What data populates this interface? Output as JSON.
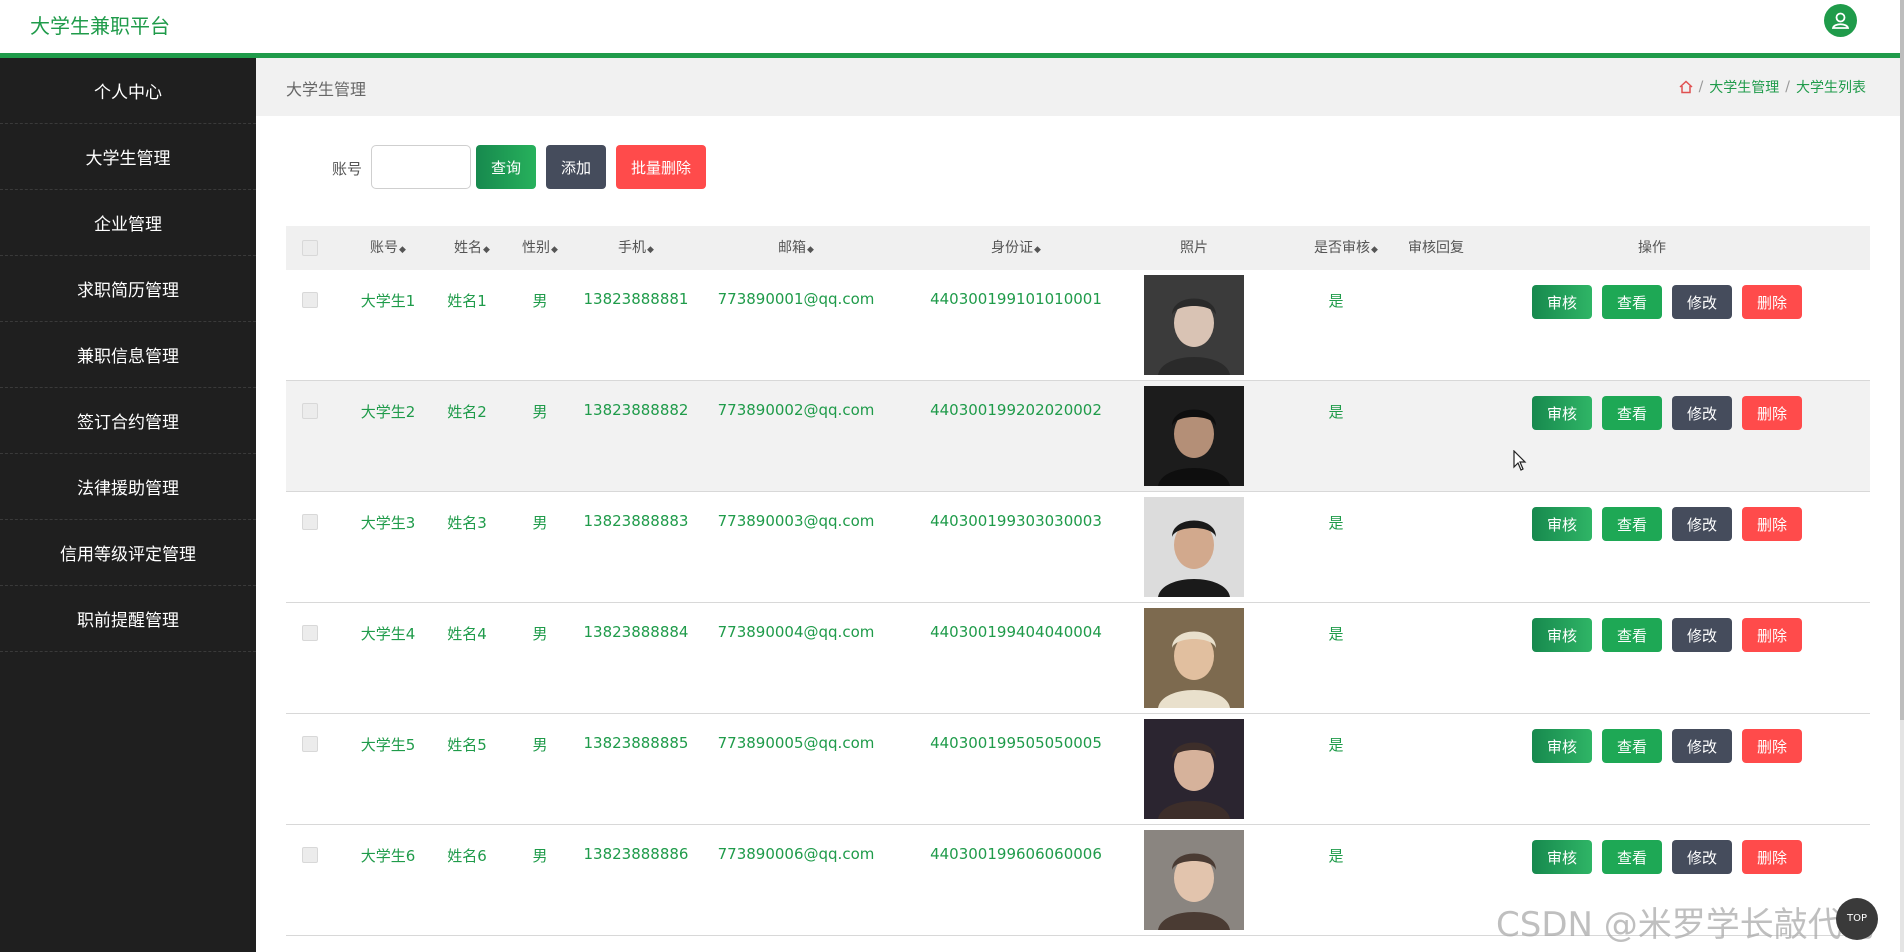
{
  "header": {
    "brand": "大学生兼职平台",
    "avatar_icon": "user-icon"
  },
  "sidebar": {
    "items": [
      {
        "label": "个人中心"
      },
      {
        "label": "大学生管理"
      },
      {
        "label": "企业管理"
      },
      {
        "label": "求职简历管理"
      },
      {
        "label": "兼职信息管理"
      },
      {
        "label": "签订合约管理"
      },
      {
        "label": "法律援助管理"
      },
      {
        "label": "信用等级评定管理"
      },
      {
        "label": "职前提醒管理"
      }
    ]
  },
  "breadcrumb": {
    "section_title": "大学生管理",
    "home_icon": "home-icon",
    "items": [
      "大学生管理",
      "大学生列表"
    ],
    "separator": "/"
  },
  "search": {
    "label": "账号",
    "value": "",
    "placeholder": "",
    "query_label": "查询",
    "add_label": "添加",
    "batch_delete_label": "批量删除"
  },
  "table": {
    "columns": [
      "账号",
      "姓名",
      "性别",
      "手机",
      "邮箱",
      "身份证",
      "照片",
      "是否审核",
      "审核回复",
      "操作"
    ],
    "sort_icon": "◆",
    "actions": {
      "audit": "审核",
      "view": "查看",
      "edit": "修改",
      "delete": "删除"
    },
    "rows": [
      {
        "account": "大学生1",
        "name": "姓名1",
        "gender": "男",
        "phone": "13823888881",
        "email": "773890001@qq.com",
        "id_card": "440300199101010001",
        "audited": "是",
        "reply": ""
      },
      {
        "account": "大学生2",
        "name": "姓名2",
        "gender": "男",
        "phone": "13823888882",
        "email": "773890002@qq.com",
        "id_card": "440300199202020002",
        "audited": "是",
        "reply": ""
      },
      {
        "account": "大学生3",
        "name": "姓名3",
        "gender": "男",
        "phone": "13823888883",
        "email": "773890003@qq.com",
        "id_card": "440300199303030003",
        "audited": "是",
        "reply": ""
      },
      {
        "account": "大学生4",
        "name": "姓名4",
        "gender": "男",
        "phone": "13823888884",
        "email": "773890004@qq.com",
        "id_card": "440300199404040004",
        "audited": "是",
        "reply": ""
      },
      {
        "account": "大学生5",
        "name": "姓名5",
        "gender": "男",
        "phone": "13823888885",
        "email": "773890005@qq.com",
        "id_card": "440300199505050005",
        "audited": "是",
        "reply": ""
      },
      {
        "account": "大学生6",
        "name": "姓名6",
        "gender": "男",
        "phone": "13823888886",
        "email": "773890006@qq.com",
        "id_card": "440300199606060006",
        "audited": "是",
        "reply": ""
      }
    ]
  },
  "watermark": "CSDN @米罗学长敲代码",
  "colors": {
    "accent": "#1f9b4a",
    "sidebar_bg": "#1f1f1f",
    "danger": "#ff4b4b",
    "dark_button": "#454c5c"
  }
}
